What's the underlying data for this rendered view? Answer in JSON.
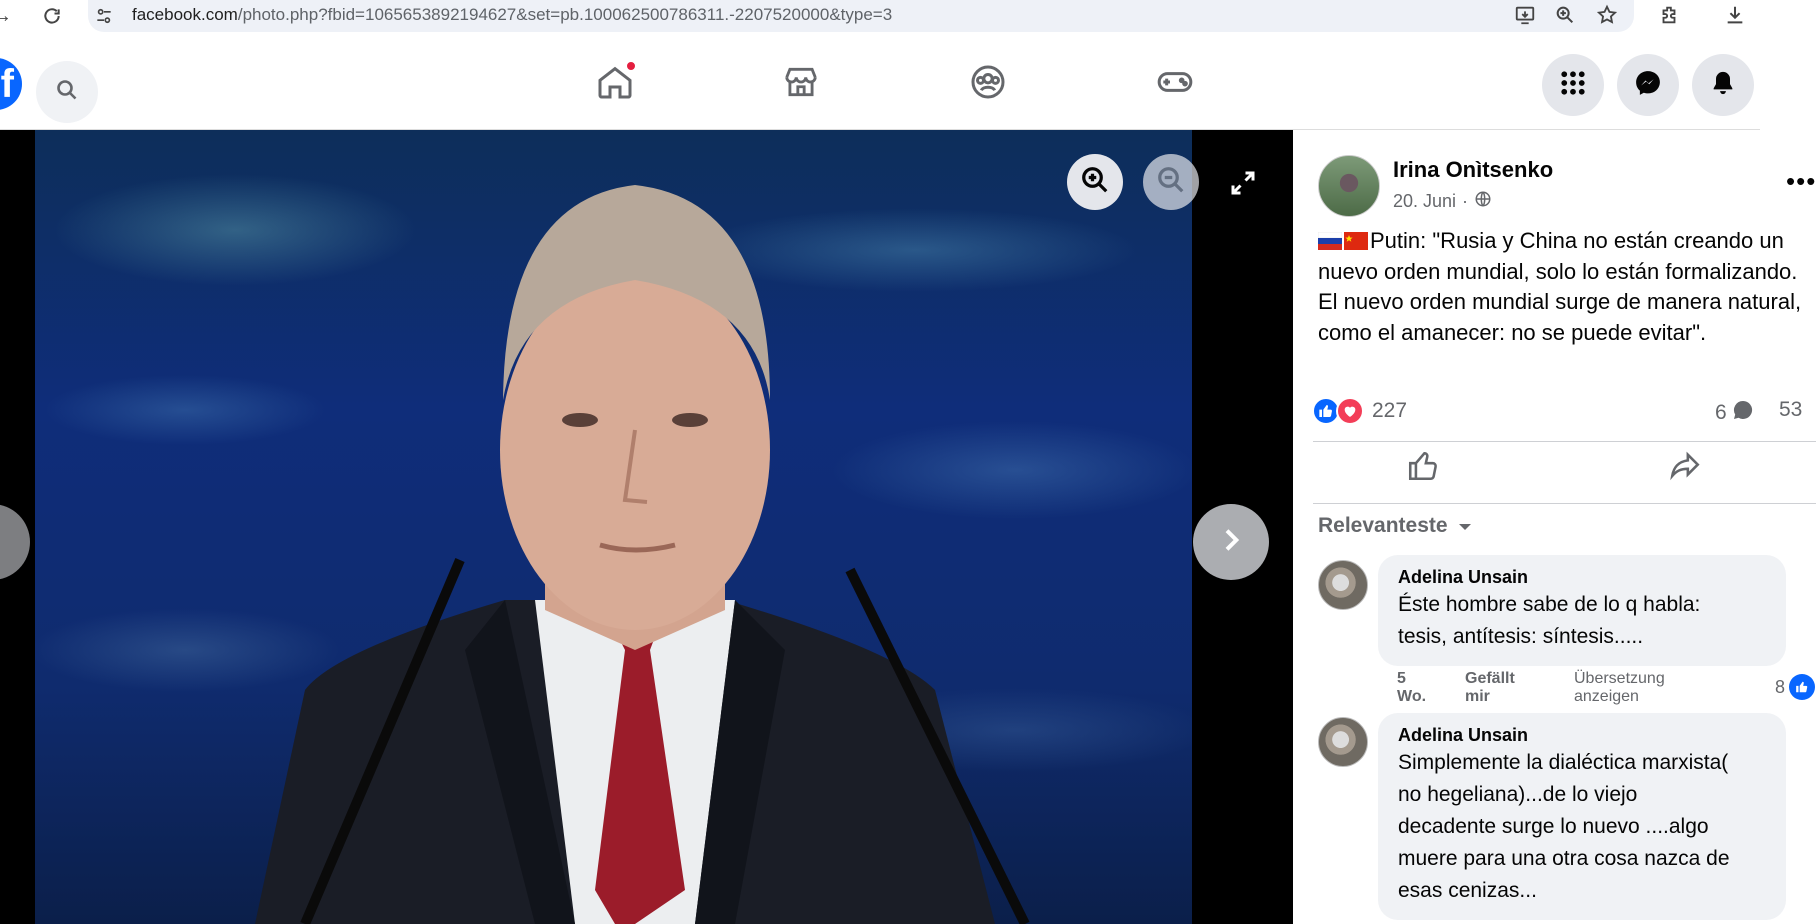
{
  "browser": {
    "url_host": "facebook.com",
    "url_rest": "/photo.php?fbid=1065653892194627&set=pb.100062500786311.-2207520000&type=3"
  },
  "fb_bar": {
    "logo_letter": "f"
  },
  "post": {
    "author": "Irina Onìtsenko",
    "date": "20. Juni",
    "separator": "·",
    "more": "•••",
    "text_lines": [
      "Putin: \"Rusia y China no están creando un",
      "nuevo orden mundial, solo lo están formalizando.",
      "El nuevo orden mundial surge de manera natural,",
      "como el amanecer: no se puede evitar\"."
    ],
    "reaction_count": "227",
    "comment_count": "6",
    "share_count": "53"
  },
  "comments_section": {
    "sort_label": "Relevanteste"
  },
  "comments": [
    {
      "name": "Adelina Unsain",
      "text_lines": [
        "Éste hombre sabe de lo q habla:",
        "tesis, antítesis: síntesis....."
      ],
      "time_line1": "5",
      "time_line2": "Wo.",
      "like_line1": "Gefällt",
      "like_line2": "mir",
      "translate_line1": "Übersetzung",
      "translate_line2": "anzeigen",
      "likes": "8"
    },
    {
      "name": "Adelina Unsain",
      "text_lines": [
        "Simplemente la dialéctica marxista(",
        "no hegeliana)...de lo viejo",
        "decadente surge lo nuevo ....algo",
        "muere para una otra cosa nazca de",
        "esas cenizas..."
      ]
    }
  ],
  "colors": {
    "fb_blue": "#0866ff",
    "love_red": "#f33e58",
    "notification_red": "#e41e3f"
  }
}
